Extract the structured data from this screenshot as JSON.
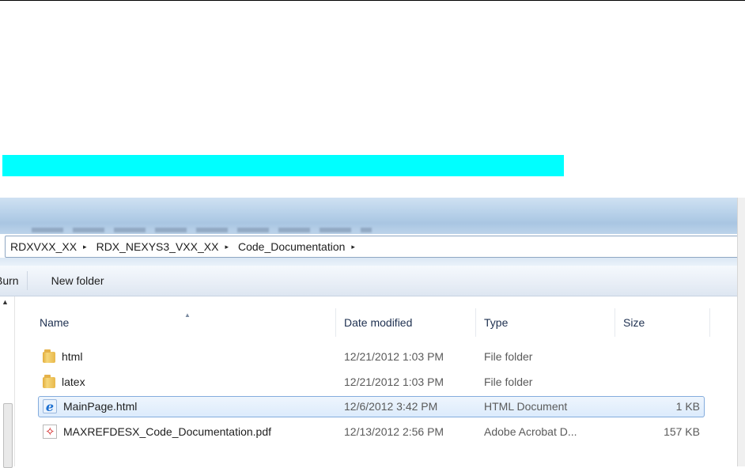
{
  "breadcrumb": [
    "RDXVXX_XX",
    "RDX_NEXYS3_VXX_XX",
    "Code_Documentation"
  ],
  "breadcrumb_arrow": "▸",
  "toolbar": {
    "burn_label": "Burn",
    "new_folder_label": "New folder"
  },
  "columns": {
    "name": "Name",
    "date": "Date modified",
    "type": "Type",
    "size": "Size"
  },
  "files": [
    {
      "name": "html",
      "date": "12/21/2012 1:03 PM",
      "type": "File folder",
      "size": "",
      "icon": "folder-icon"
    },
    {
      "name": "latex",
      "date": "12/21/2012 1:03 PM",
      "type": "File folder",
      "size": "",
      "icon": "folder-icon"
    },
    {
      "name": "MainPage.html",
      "date": "12/6/2012 3:42 PM",
      "type": "HTML Document",
      "size": "1 KB",
      "icon": "internet-explorer-icon",
      "selected": true
    },
    {
      "name": "MAXREFDESX_Code_Documentation.pdf",
      "date": "12/13/2012 2:56 PM",
      "type": "Adobe Acrobat D...",
      "size": "157 KB",
      "icon": "pdf-icon"
    }
  ],
  "colors": {
    "highlight": "#00ffff",
    "selection_border": "#84acdd"
  }
}
